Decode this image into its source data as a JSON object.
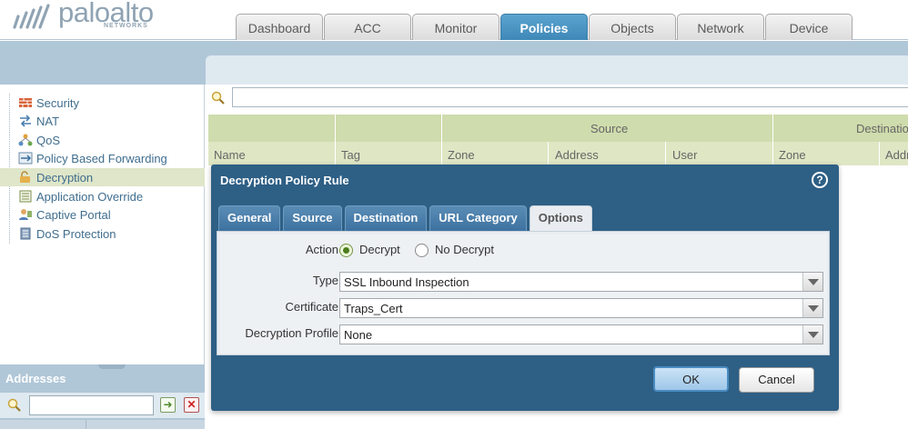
{
  "brand": {
    "name": "paloalto",
    "sub": "NETWORKS"
  },
  "nav": {
    "tabs": [
      {
        "label": "Dashboard",
        "active": false
      },
      {
        "label": "ACC",
        "active": false
      },
      {
        "label": "Monitor",
        "active": false
      },
      {
        "label": "Policies",
        "active": true
      },
      {
        "label": "Objects",
        "active": false
      },
      {
        "label": "Network",
        "active": false
      },
      {
        "label": "Device",
        "active": false
      }
    ]
  },
  "sidebar": {
    "items": [
      {
        "label": "Security",
        "icon": "security-icon"
      },
      {
        "label": "NAT",
        "icon": "nat-icon"
      },
      {
        "label": "QoS",
        "icon": "qos-icon"
      },
      {
        "label": "Policy Based Forwarding",
        "icon": "pbf-icon"
      },
      {
        "label": "Decryption",
        "icon": "decryption-icon",
        "selected": true
      },
      {
        "label": "Application Override",
        "icon": "app-override-icon"
      },
      {
        "label": "Captive Portal",
        "icon": "captive-portal-icon"
      },
      {
        "label": "DoS Protection",
        "icon": "dos-protection-icon"
      }
    ],
    "addresses": {
      "title": "Addresses",
      "search_placeholder": ""
    }
  },
  "grid": {
    "groups": {
      "source": "Source",
      "destination": "Destinatio"
    },
    "columns": {
      "name": "Name",
      "tag": "Tag",
      "src_zone": "Zone",
      "src_address": "Address",
      "src_user": "User",
      "dst_zone": "Zone",
      "dst_address": "Addr"
    }
  },
  "dialog": {
    "title": "Decryption Policy Rule",
    "tabs": [
      {
        "label": "General",
        "active": false
      },
      {
        "label": "Source",
        "active": false
      },
      {
        "label": "Destination",
        "active": false
      },
      {
        "label": "URL Category",
        "active": false
      },
      {
        "label": "Options",
        "active": true
      }
    ],
    "action": {
      "label": "Action",
      "decrypt": "Decrypt",
      "no_decrypt": "No Decrypt",
      "selected": "Decrypt"
    },
    "type": {
      "label": "Type",
      "value": "SSL Inbound Inspection"
    },
    "certificate": {
      "label": "Certificate",
      "value": "Traps_Cert"
    },
    "decryption_profile": {
      "label": "Decryption Profile",
      "value": "None"
    },
    "ok_label": "OK",
    "cancel_label": "Cancel"
  },
  "colors": {
    "accent": "#3f88b8",
    "dialog_bg": "#2e5f85",
    "selected_row": "#dfe6c9"
  }
}
